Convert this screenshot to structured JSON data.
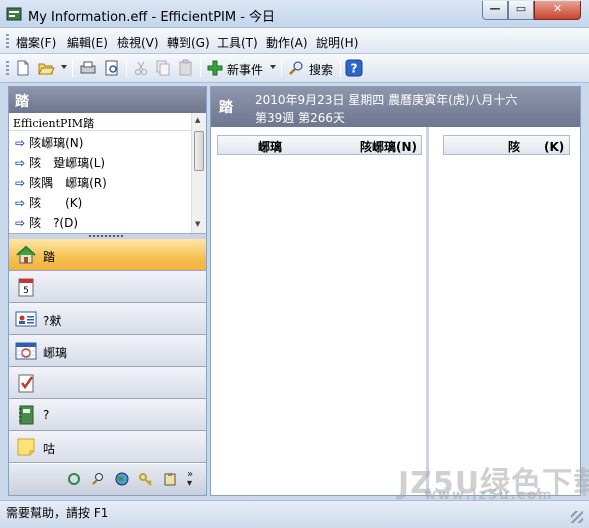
{
  "window": {
    "title": "My Information.eff - EfficientPIM - 今日",
    "minimize": "—",
    "maximize": "▭",
    "close": "✕"
  },
  "menu": {
    "items": [
      "檔案(F)",
      "編輯(E)",
      "檢視(V)",
      "轉到(G)",
      "工具(T)",
      "動作(A)",
      "說明(H)"
    ]
  },
  "toolbar": {
    "new_event_label": "新事件",
    "search_label": "搜索",
    "icons": [
      "new-document-icon",
      "open-folder-icon",
      "print-icon",
      "print-preview-icon",
      "cut-icon",
      "copy-icon",
      "paste-icon",
      "add-icon",
      "search-icon",
      "help-icon"
    ]
  },
  "left": {
    "header": "踏",
    "tree_title": "EfficientPIM踏",
    "tree_items": [
      "陔峫璃(N)",
      "陔　跫峫璃(L)",
      "陔隅　峫璃(R)",
      "陔　　(K)",
      "陔　?(D)"
    ],
    "nav": [
      {
        "label": "踏",
        "icon": "home-icon"
      },
      {
        "label": "",
        "icon": "calendar-icon"
      },
      {
        "label": "?猌",
        "icon": "contacts-icon"
      },
      {
        "label": "峫璃",
        "icon": "schedule-icon"
      },
      {
        "label": "",
        "icon": "tasks-icon"
      },
      {
        "label": "?",
        "icon": "notebook-icon"
      },
      {
        "label": "咕",
        "icon": "notes-icon"
      }
    ]
  },
  "right": {
    "header_title": "踏",
    "date_line": "2010年9月23日 星期四 農曆庚寅年(虎)八月十六",
    "week_line": "第39週 第266天",
    "col_a_title": "峫璃",
    "col_a_new": "陔峫璃(N)",
    "col_b_new": "陔　　(K)"
  },
  "status": {
    "text": "需要幫助，請按 F1"
  },
  "watermark": {
    "line1": "JZ5U绿色下载",
    "line2": "www.jz5u.com"
  },
  "colors": {
    "header_gradient": "#7c84a0",
    "active_nav": "#f6c152",
    "title_bar": "#c3d5ec"
  }
}
